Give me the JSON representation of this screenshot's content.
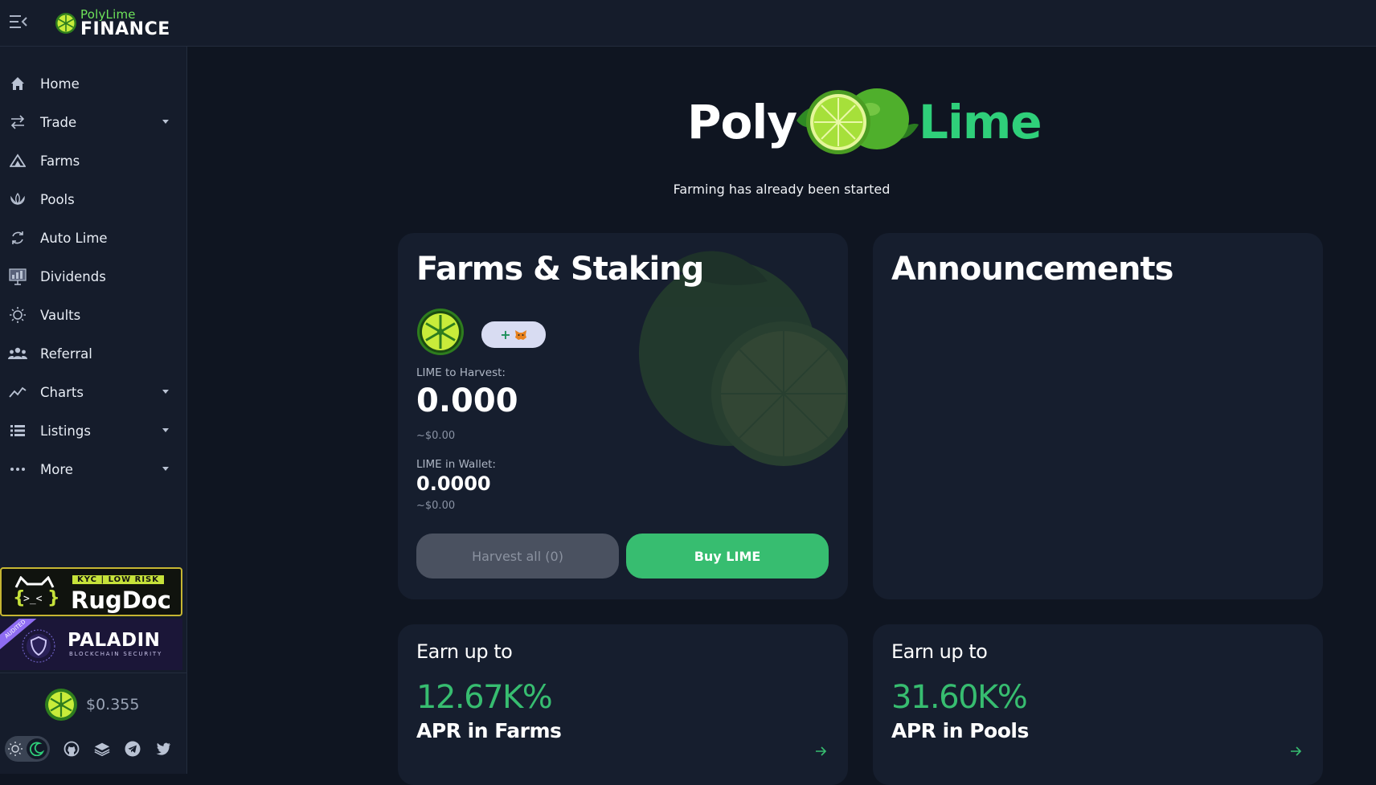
{
  "brand": {
    "small": "PolyLime",
    "big": "FINANCE"
  },
  "nav": [
    {
      "label": "Home",
      "icon": "home-icon"
    },
    {
      "label": "Trade",
      "icon": "swap-icon",
      "caret": true
    },
    {
      "label": "Farms",
      "icon": "farm-icon"
    },
    {
      "label": "Pools",
      "icon": "pool-icon"
    },
    {
      "label": "Auto Lime",
      "icon": "refresh-icon"
    },
    {
      "label": "Dividends",
      "icon": "dividends-icon"
    },
    {
      "label": "Vaults",
      "icon": "vault-icon"
    },
    {
      "label": "Referral",
      "icon": "referral-icon"
    },
    {
      "label": "Charts",
      "icon": "chart-icon",
      "caret": true
    },
    {
      "label": "Listings",
      "icon": "list-icon",
      "caret": true
    },
    {
      "label": "More",
      "icon": "more-icon",
      "caret": true
    }
  ],
  "badges": {
    "rugdoc": {
      "tag": "KYC | LOW RISK",
      "name": "RugDoc"
    },
    "paladin": {
      "ribbon": "AUDITED",
      "name": "PALADIN",
      "sub": "BLOCKCHAIN SECURITY"
    }
  },
  "price": "$0.355",
  "hero": {
    "poly": "Poly",
    "lime": "Lime",
    "subtitle": "Farming has already been started"
  },
  "farms": {
    "title": "Farms & Staking",
    "mm_label": "+",
    "harvest_label": "LIME to Harvest:",
    "harvest_value": "0.000",
    "harvest_usd": "~$0.00",
    "wallet_label": "LIME in Wallet:",
    "wallet_value": "0.0000",
    "wallet_usd": "~$0.00",
    "harvest_button": "Harvest all (0)",
    "buy_button": "Buy LIME"
  },
  "announcements": {
    "title": "Announcements"
  },
  "earn_farms": {
    "heading": "Earn up to",
    "value": "12.67K%",
    "label": "APR in Farms"
  },
  "earn_pools": {
    "heading": "Earn up to",
    "value": "31.60K%",
    "label": "APR in Pools"
  },
  "colors": {
    "accent": "#37bd70",
    "lime": "#2fcf7a",
    "bg": "#0f1521",
    "panel": "#151c2b",
    "card": "#161e2e"
  }
}
